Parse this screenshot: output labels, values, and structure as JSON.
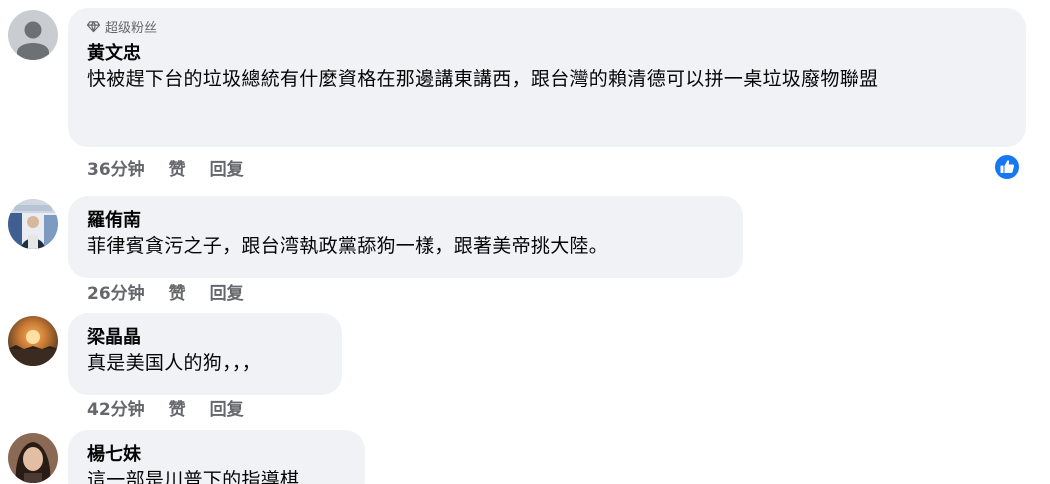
{
  "comments": [
    {
      "badge": "超级粉丝",
      "author": "黄文忠",
      "text": "快被趕下台的垃圾總統有什麼資格在那邊講東講西，跟台灣的賴清德可以拼一桌垃圾廢物聯盟",
      "time": "36分钟",
      "like_label": "赞",
      "reply_label": "回复"
    },
    {
      "author": "羅侑南",
      "text": "菲律賓貪污之子，跟台湾執政黨舔狗一樣，跟著美帝挑大陸。",
      "time": "26分钟",
      "like_label": "赞",
      "reply_label": "回复"
    },
    {
      "author": "梁晶晶",
      "text": "真是美国人的狗，，，",
      "time": "42分钟",
      "like_label": "赞",
      "reply_label": "回复"
    },
    {
      "author": "楊七妹",
      "text": "這一部是川普下的指導棋"
    }
  ],
  "icons": {
    "badge": "diamond-icon",
    "reaction": "thumbs-up-icon"
  },
  "colors": {
    "bubble": "#f0f2f5",
    "secondary_text": "#65676b",
    "like_blue": "#1877f2"
  }
}
